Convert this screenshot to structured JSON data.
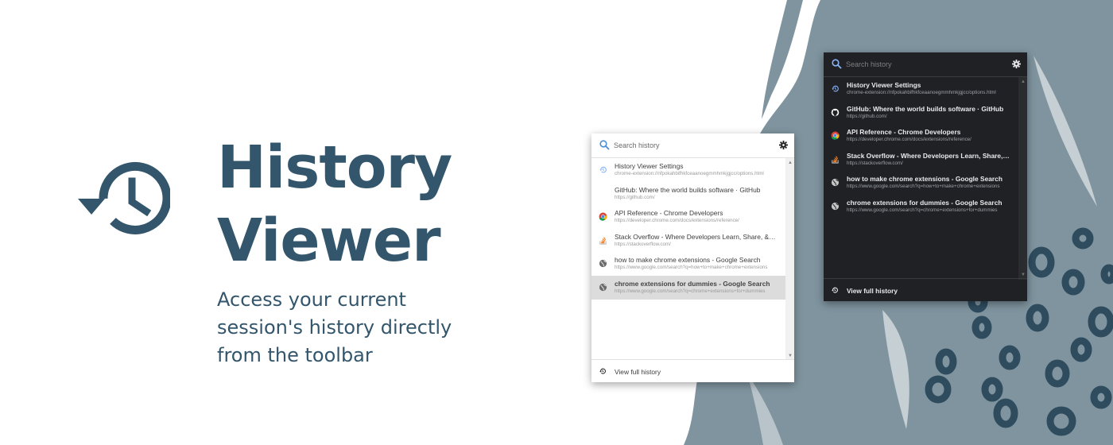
{
  "colors": {
    "brand": "#33566c",
    "background_art": "#7f949f",
    "light_popup_bg": "#ffffff",
    "dark_popup_bg": "#202124",
    "selected_row": "#dcdcdc"
  },
  "hero": {
    "icon": "history-icon",
    "title_line1": "History",
    "title_line2": "Viewer",
    "subtitle": "Access your current session's history directly from the toolbar"
  },
  "popup_light": {
    "search_placeholder": "Search history",
    "items": [
      {
        "title": "History Viewer Settings",
        "url": "chrome-extension://nfpokahbifhkfceaanoegmmhmkjgjcc/options.html",
        "icon": "history-icon",
        "selected": false
      },
      {
        "title": "GitHub: Where the world builds software · GitHub",
        "url": "https://github.com/",
        "icon": "github-icon",
        "selected": false
      },
      {
        "title": "API Reference - Chrome Developers",
        "url": "https://developer.chrome.com/docs/extensions/reference/",
        "icon": "chrome-icon",
        "selected": false
      },
      {
        "title": "Stack Overflow - Where Developers Learn, Share, &amp; Build Careers",
        "url": "https://stackoverflow.com/",
        "icon": "stackoverflow-icon",
        "selected": false
      },
      {
        "title": "how to make chrome extensions - Google Search",
        "url": "https://www.google.com/search?q=how+to+make+chrome+extensions",
        "icon": "globe-icon",
        "selected": false
      },
      {
        "title": "chrome extensions for dummies - Google Search",
        "url": "https://www.google.com/search?q=chrome+extensions+for+dummies",
        "icon": "globe-icon",
        "selected": true
      }
    ],
    "footer_label": "View full history"
  },
  "popup_dark": {
    "search_placeholder": "Search history",
    "items": [
      {
        "title": "History Viewer Settings",
        "url": "chrome-extension://nfpokahbifhkfceaanoegmmhmkjgjcc/options.html",
        "icon": "history-icon"
      },
      {
        "title": "GitHub: Where the world builds software · GitHub",
        "url": "https://github.com/",
        "icon": "github-icon"
      },
      {
        "title": "API Reference - Chrome Developers",
        "url": "https://developer.chrome.com/docs/extensions/reference/",
        "icon": "chrome-icon"
      },
      {
        "title": "Stack Overflow - Where Developers Learn, Share, &amp; Build Careers",
        "url": "https://stackoverflow.com/",
        "icon": "stackoverflow-icon"
      },
      {
        "title": "how to make chrome extensions - Google Search",
        "url": "https://www.google.com/search?q=how+to+make+chrome+extensions",
        "icon": "globe-icon"
      },
      {
        "title": "chrome extensions for dummies - Google Search",
        "url": "https://www.google.com/search?q=chrome+extensions+for+dummies",
        "icon": "globe-icon"
      }
    ],
    "footer_label": "View full history"
  }
}
